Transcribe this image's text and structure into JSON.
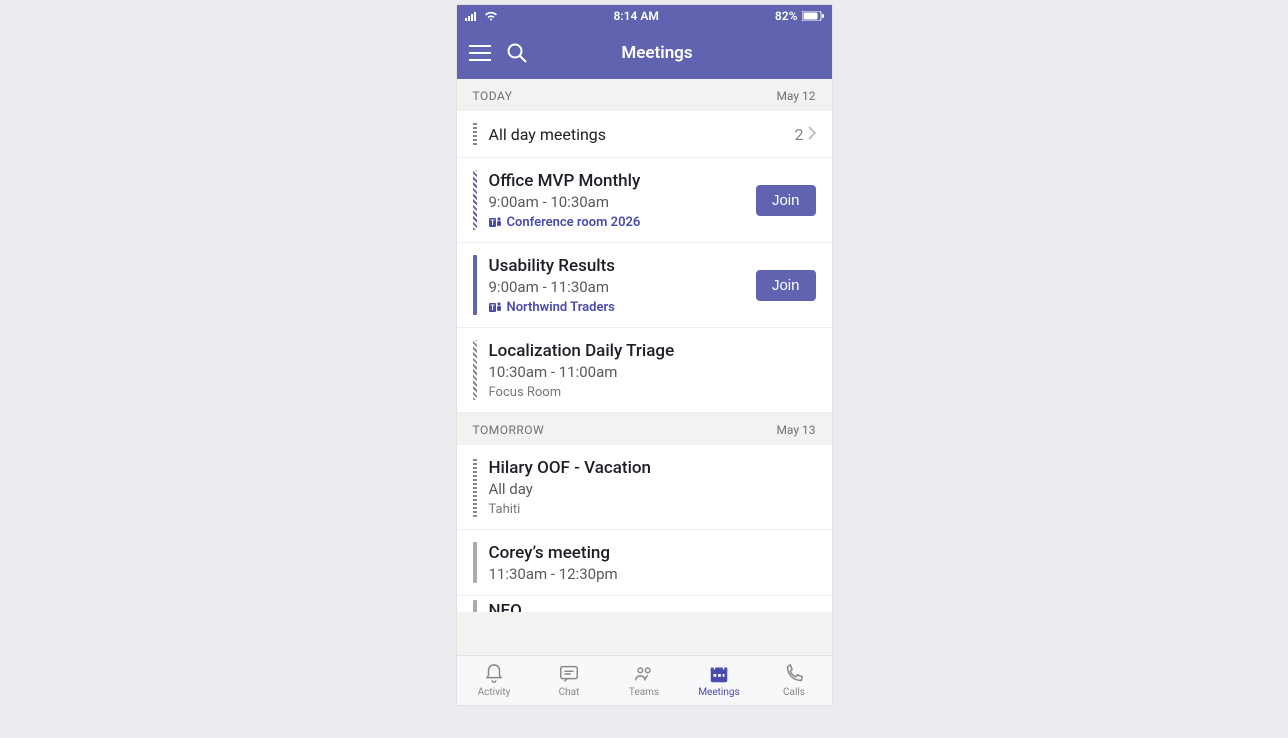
{
  "status": {
    "time": "8:14 AM",
    "battery": "82%"
  },
  "header": {
    "title": "Meetings"
  },
  "sections": [
    {
      "label": "TODAY",
      "date": "May 12",
      "allday": {
        "text": "All day meetings",
        "count": "2"
      },
      "meetings": [
        {
          "title": "Office MVP Monthly",
          "time": "9:00am - 10:30am",
          "location": "Conference room 2026",
          "locStyle": "teams",
          "accent": "hatched",
          "join": "Join"
        },
        {
          "title": "Usability Results",
          "time": "9:00am - 11:30am",
          "location": "Northwind Traders",
          "locStyle": "teams",
          "accent": "solid",
          "join": "Join"
        },
        {
          "title": "Localization Daily Triage",
          "time": "10:30am - 11:00am",
          "location": "Focus Room",
          "locStyle": "plain",
          "accent": "hatched-grey"
        }
      ]
    },
    {
      "label": "TOMORROW",
      "date": "May 13",
      "meetings": [
        {
          "title": "Hilary OOF - Vacation",
          "time": "All day",
          "location": "Tahiti",
          "locStyle": "plain",
          "accent": "grey-solid"
        },
        {
          "title": "Corey’s meeting",
          "time": "11:30am - 12:30pm",
          "accent": "grey-line"
        },
        {
          "title": "NEO",
          "partial": true,
          "accent": "grey-line"
        }
      ]
    }
  ],
  "tabs": [
    {
      "label": "Activity"
    },
    {
      "label": "Chat"
    },
    {
      "label": "Teams"
    },
    {
      "label": "Meetings"
    },
    {
      "label": "Calls"
    }
  ]
}
